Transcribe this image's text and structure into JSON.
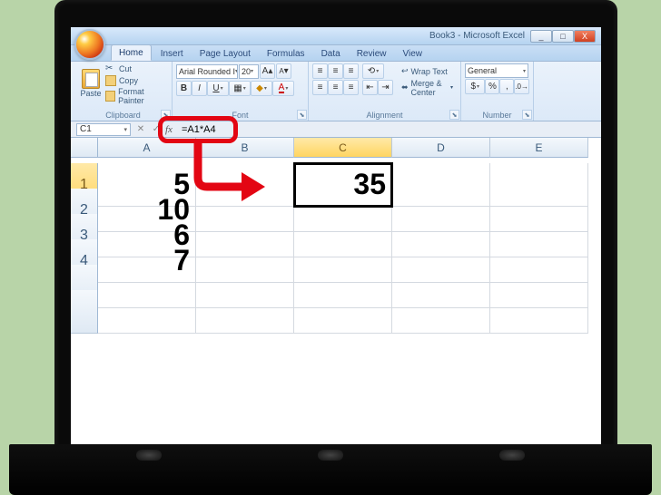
{
  "app": {
    "title": "Book3 - Microsoft Excel"
  },
  "win": {
    "min": "_",
    "max": "□",
    "close": "X"
  },
  "tabs": {
    "home": "Home",
    "insert": "Insert",
    "page_layout": "Page Layout",
    "formulas": "Formulas",
    "data": "Data",
    "review": "Review",
    "view": "View"
  },
  "ribbon": {
    "clipboard": {
      "paste": "Paste",
      "cut": "Cut",
      "copy": "Copy",
      "format_painter": "Format Painter",
      "label": "Clipboard"
    },
    "font": {
      "name": "Arial Rounded I",
      "size": "20",
      "grow": "A",
      "shrink": "A",
      "bold": "B",
      "italic": "I",
      "underline": "U",
      "label": "Font"
    },
    "alignment": {
      "wrap": "Wrap Text",
      "merge": "Merge & Center",
      "label": "Alignment"
    },
    "number": {
      "format": "General",
      "label": "Number"
    }
  },
  "formula_bar": {
    "cell_ref": "C1",
    "fx": "fx",
    "formula": "=A1*A4"
  },
  "columns": {
    "A": "A",
    "B": "B",
    "C": "C",
    "D": "D",
    "E": "E"
  },
  "rows": {
    "r1": "1",
    "r2": "2",
    "r3": "3",
    "r4": "4"
  },
  "cells": {
    "A1": "5",
    "B1": "",
    "C1": "35",
    "D1": "",
    "E1": "",
    "A2": "10",
    "B2": "",
    "C2": "",
    "D2": "",
    "E2": "",
    "A3": "6",
    "B3": "",
    "C3": "",
    "D3": "",
    "E3": "",
    "A4": "7",
    "B4": "",
    "C4": "",
    "D4": "",
    "E4": ""
  },
  "selected_cell": "C1"
}
